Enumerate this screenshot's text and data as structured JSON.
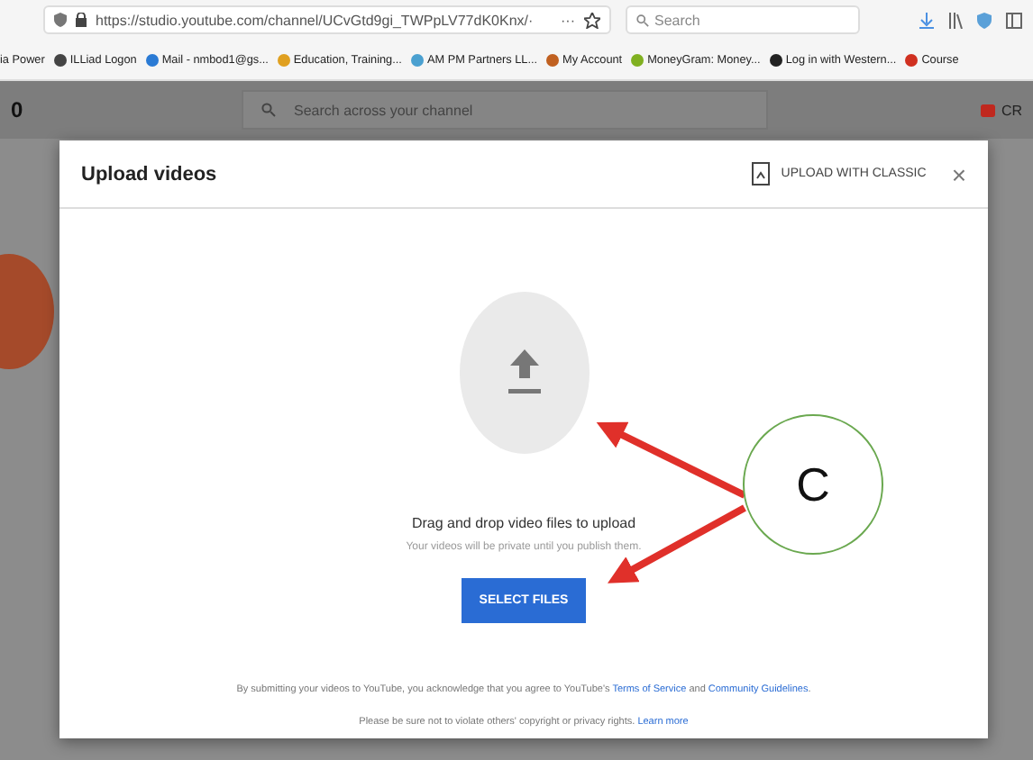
{
  "browser": {
    "url": "https://studio.youtube.com/channel/UCvGtd9gi_TWPpLV77dK0Knx/·",
    "more": "···",
    "search_placeholder": "Search",
    "bookmarks": [
      {
        "label": "ia Power"
      },
      {
        "label": "ILLiad Logon"
      },
      {
        "label": "Mail - nmbod1@gs..."
      },
      {
        "label": "Education, Training..."
      },
      {
        "label": "AM PM Partners LL..."
      },
      {
        "label": "My Account"
      },
      {
        "label": "MoneyGram: Money..."
      },
      {
        "label": "Log in with Western..."
      },
      {
        "label": "Course"
      }
    ]
  },
  "page": {
    "logo_fragment": "0",
    "search_placeholder": "Search across your channel",
    "create_fragment": "CR"
  },
  "dialog": {
    "title": "Upload videos",
    "classic_button": "UPLOAD WITH CLASSIC",
    "close": "×",
    "drop_title": "Drag and drop video files to upload",
    "drop_subtitle": "Your videos will be private until you publish them.",
    "select_button": "SELECT FILES",
    "footer_line_1_parts": [
      "By submitting your videos to YouTube, you acknowledge that you agree to YouTube's ",
      "Terms of Service",
      " and ",
      "Community Guidelines",
      "."
    ],
    "footer_line_2_parts": [
      "Please be sure not to violate others' copyright or privacy rights. ",
      "Learn more"
    ]
  },
  "annotation": {
    "label": "C"
  }
}
